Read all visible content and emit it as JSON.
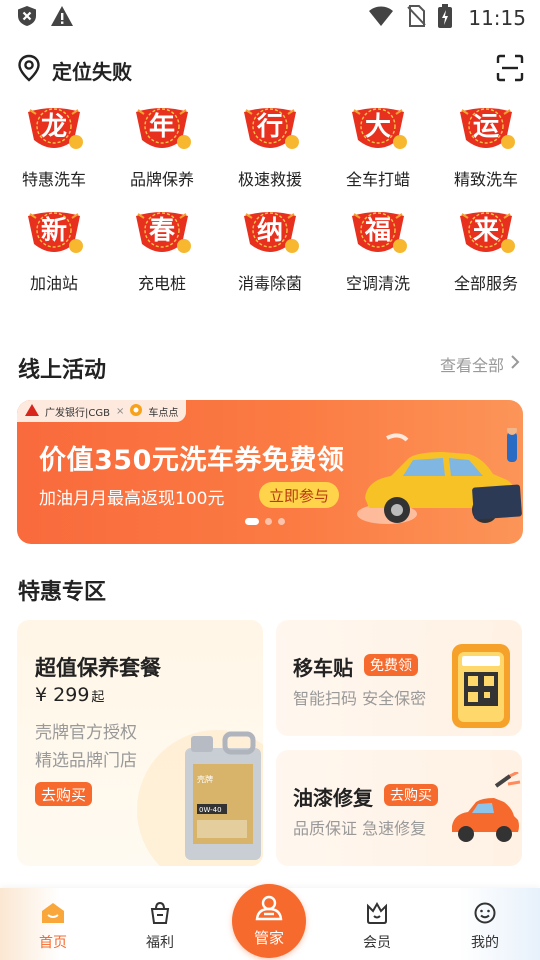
{
  "status_bar": {
    "time": "11:15",
    "icons": [
      "shield-icon",
      "warning-icon",
      "wifi-icon",
      "no-sim-icon",
      "battery-charging-icon"
    ]
  },
  "location": {
    "text": "定位失败",
    "icon": "location-pin-icon",
    "scan_icon": "scan-icon"
  },
  "services": [
    {
      "badge": "龙",
      "label": "特惠洗车"
    },
    {
      "badge": "年",
      "label": "品牌保养"
    },
    {
      "badge": "行",
      "label": "极速救援"
    },
    {
      "badge": "大",
      "label": "全车打蜡"
    },
    {
      "badge": "运",
      "label": "精致洗车"
    },
    {
      "badge": "新",
      "label": "加油站"
    },
    {
      "badge": "春",
      "label": "充电桩"
    },
    {
      "badge": "纳",
      "label": "消毒除菌"
    },
    {
      "badge": "福",
      "label": "空调清洗"
    },
    {
      "badge": "来",
      "label": "全部服务"
    }
  ],
  "activities": {
    "title": "线上活动",
    "see_all": "查看全部",
    "banner": {
      "partner_bank": "广发银行|CGB",
      "partner_x": "×",
      "partner_app": "车点点",
      "title": "价值350元洗车券免费领",
      "subtitle": "加油月月最高返现100元",
      "cta": "立即参与",
      "slides": 3,
      "active_slide": 1
    }
  },
  "deals": {
    "title": "特惠专区",
    "main_card": {
      "title": "超值保养套餐",
      "price_prefix": "¥",
      "price": "299",
      "price_suffix": "起",
      "line1": "壳牌官方授权",
      "line2": "精选品牌门店",
      "button": "去购买",
      "oil_label_brand": "壳牌",
      "oil_label_grade": "0W-40"
    },
    "move_card": {
      "title": "移车贴",
      "tag": "免费领",
      "subtitle": "智能扫码 安全保密"
    },
    "paint_card": {
      "title": "油漆修复",
      "tag": "去购买",
      "subtitle": "品质保证 急速修复"
    }
  },
  "bottom_nav": {
    "items": [
      {
        "label": "首页",
        "active": true
      },
      {
        "label": "福利",
        "active": false
      },
      {
        "label": "管家",
        "active": false
      },
      {
        "label": "会员",
        "active": false
      },
      {
        "label": "我的",
        "active": false
      }
    ]
  },
  "colors": {
    "accent": "#f66a2d",
    "badge_red": "#e8301f",
    "banner_orange": "#fb7b43"
  }
}
